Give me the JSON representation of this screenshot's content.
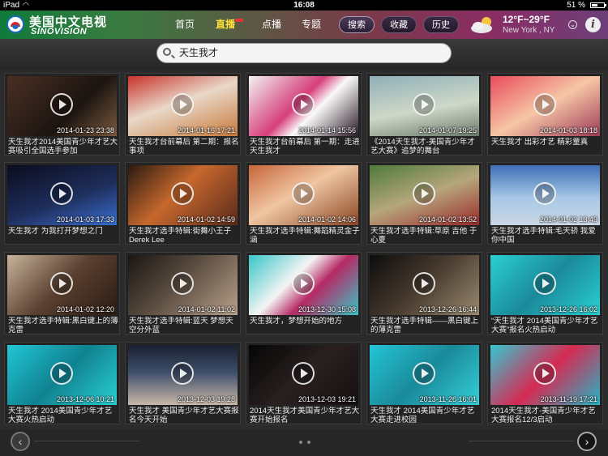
{
  "status": {
    "carrier": "iPad",
    "time": "16:08",
    "battery": "51 %",
    "battery_level": 0.51
  },
  "brand": {
    "cn": "美国中文电视",
    "en": "SINOVISION"
  },
  "nav": {
    "home": "首页",
    "live": "直播",
    "vod": "点播",
    "topics": "专题",
    "search": "搜索",
    "favorites": "收藏",
    "history": "历史"
  },
  "weather": {
    "temp": "12°F~29°F",
    "city": "New York , NY",
    "icon": "cloud-sun-icon"
  },
  "search": {
    "query": "天生我才"
  },
  "videos": [
    {
      "date": "2014-01-23 23:38",
      "title": "天生我才2014美国青少年才艺大赛吸引全国选手参加"
    },
    {
      "date": "2014-01-16 17:21",
      "title": "天生我才台前幕后 第二期：报名事项"
    },
    {
      "date": "2014-01-14 15:56",
      "title": "天生我才台前幕后 第一期：走进天生我才"
    },
    {
      "date": "2014-01-07 19:25",
      "title": "《2014天生我才-美国青少年才艺大赛》追梦的舞台"
    },
    {
      "date": "2014-01-03 18:18",
      "title": "天生我才 出彩才艺 精彩童真"
    },
    {
      "date": "2014-01-03 17:33",
      "title": "天生我才 为我打开梦想之门"
    },
    {
      "date": "2014-01-02 14:59",
      "title": "天生我才选手特辑:街舞小王子Derek Lee"
    },
    {
      "date": "2014-01-02 14:06",
      "title": "天生我才选手特辑:舞蹈精灵金子涵"
    },
    {
      "date": "2014-01-02 13:52",
      "title": "天生我才选手特辑:草原 吉他 于心夏"
    },
    {
      "date": "2014-01-02 13:49",
      "title": "天生我才选手特辑:毛天骄 我爱你中国"
    },
    {
      "date": "2014-01-02 12:20",
      "title": "天生我才选手特辑:黑白键上的薄克雷"
    },
    {
      "date": "2014-01-02 11:02",
      "title": "天生我才选手特辑:蓝天 梦想天空分外蓝"
    },
    {
      "date": "2013-12-30 15:08",
      "title": "天生我才，梦想开始的地方"
    },
    {
      "date": "2013-12-26 16:44",
      "title": "天生我才选手特辑——黑白键上的薄克雷"
    },
    {
      "date": "2013-12-26 16:02",
      "title": "“天生我才 2014美国青少年才艺大赛”报名火热启动"
    },
    {
      "date": "2013-12-06 10:21",
      "title": "天生我才 2014美国青少年才艺大赛火热启动"
    },
    {
      "date": "2013-12-03 19:28",
      "title": "天生我才 美国青少年才艺大赛报名今天开始"
    },
    {
      "date": "2013-12-03 19:21",
      "title": "2014天生我才美国青少年才艺大赛开始报名"
    },
    {
      "date": "2013-11-26 16:01",
      "title": "天生我才 2014美国青少年才艺大赛走进校园"
    },
    {
      "date": "2013-11-19 17:21",
      "title": "2014天生我才-美国青少年才艺大赛报名12/3启动"
    }
  ],
  "pager": {
    "prev": "‹",
    "next": "›",
    "pages": 2
  }
}
